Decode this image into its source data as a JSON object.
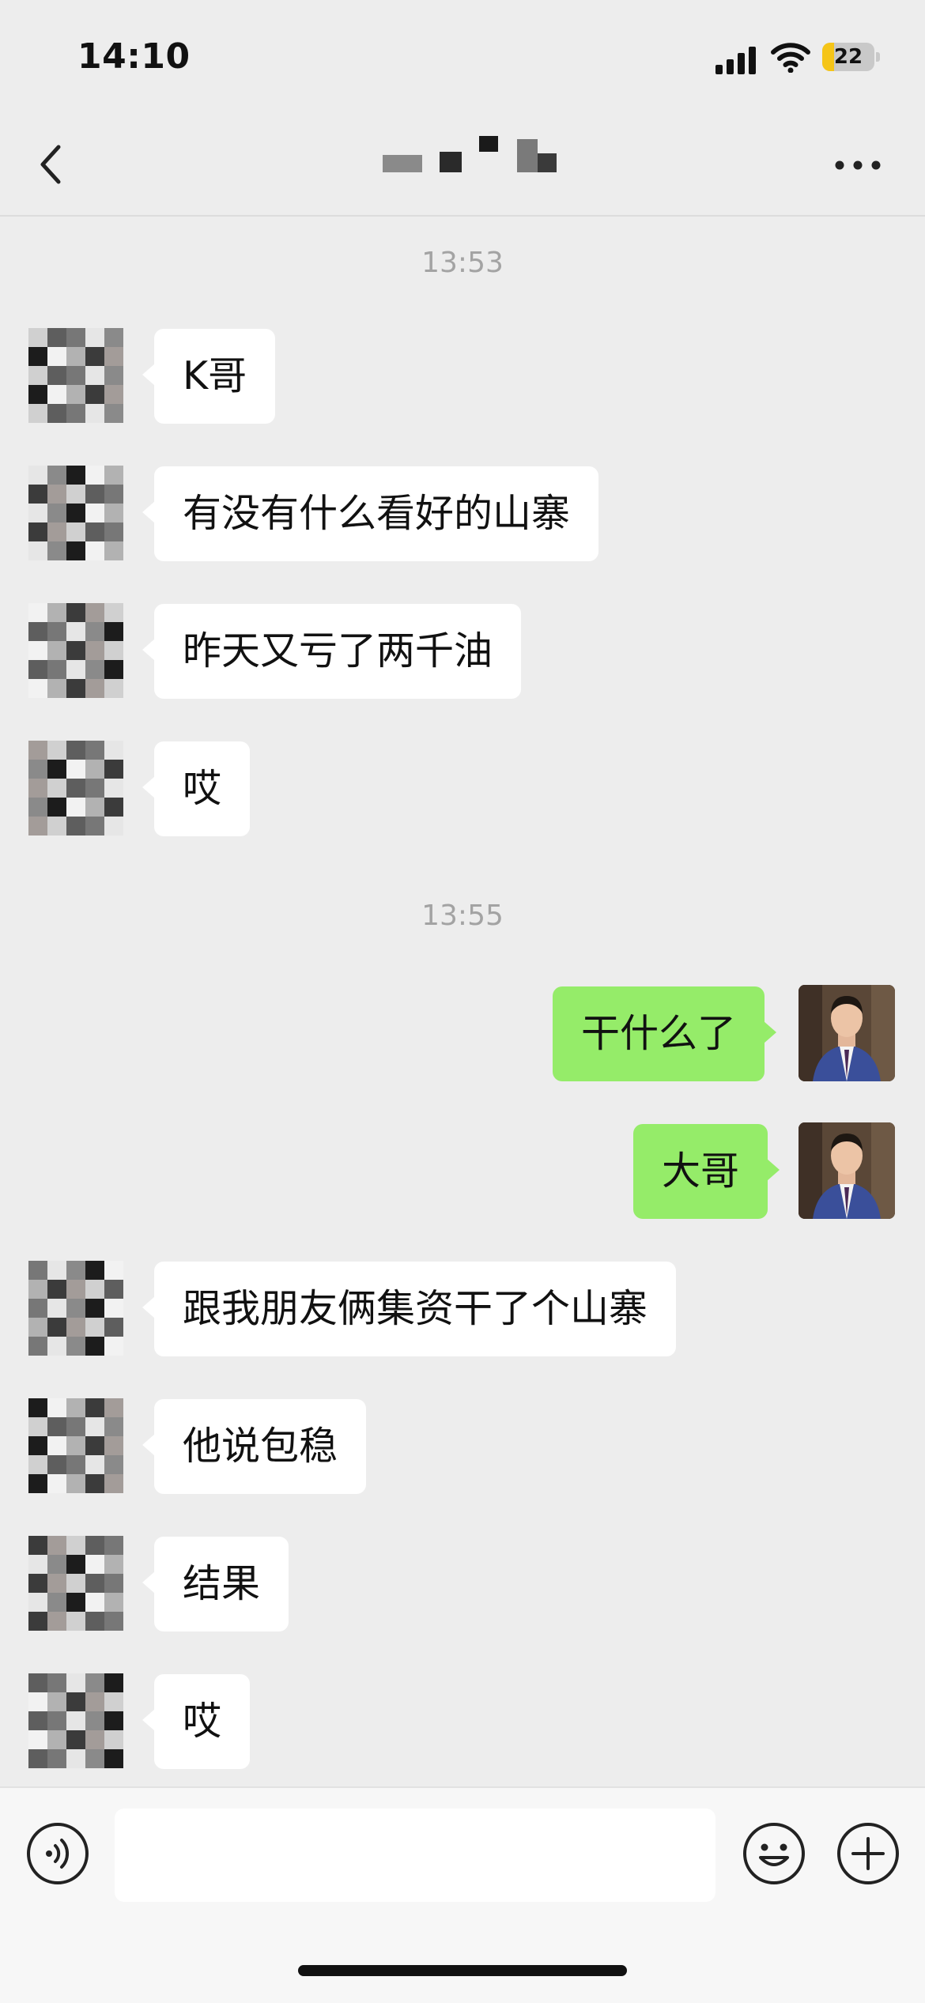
{
  "status_bar": {
    "time": "14:10",
    "battery": "22",
    "battery_level": 0.22,
    "icons": [
      "signal-icon",
      "wifi-icon",
      "battery-charging-icon"
    ]
  },
  "header": {
    "back_icon": "chevron-left-icon",
    "title": "",
    "more_icon": "more-dots-icon"
  },
  "timestamps": [
    "13:53",
    "13:55"
  ],
  "messages": [
    {
      "from": "contact",
      "text": "K哥"
    },
    {
      "from": "contact",
      "text": "有没有什么看好的山寨"
    },
    {
      "from": "contact",
      "text": "昨天又亏了两千油"
    },
    {
      "from": "contact",
      "text": "哎"
    },
    {
      "from": "me",
      "text": "干什么了"
    },
    {
      "from": "me",
      "text": "大哥"
    },
    {
      "from": "contact",
      "text": "跟我朋友俩集资干了个山寨"
    },
    {
      "from": "contact",
      "text": "他说包稳"
    },
    {
      "from": "contact",
      "text": "结果"
    },
    {
      "from": "contact",
      "text": "哎"
    }
  ],
  "input_bar": {
    "placeholder": "",
    "icons": [
      "voice-icon",
      "emoji-icon",
      "plus-icon"
    ]
  },
  "colors": {
    "background": "#ededed",
    "incoming_bubble": "#ffffff",
    "outgoing_bubble": "#95ec69",
    "timestamp": "#a3a3a3"
  }
}
